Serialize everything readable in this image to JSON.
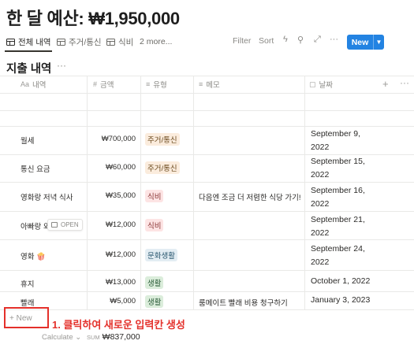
{
  "page": {
    "title": "한 달 예산: ₩1,950,000"
  },
  "views": {
    "tabs": [
      {
        "label": "전체 내역"
      },
      {
        "label": "주거/통신"
      },
      {
        "label": "식비"
      }
    ],
    "more": "2 more..."
  },
  "toolbar": {
    "filter": "Filter",
    "sort": "Sort",
    "new_label": "New",
    "icons": [
      "lightning-icon",
      "search-icon",
      "expand-icon",
      "more-icon"
    ]
  },
  "section": {
    "title": "지출 내역",
    "more": "···"
  },
  "columns": [
    {
      "icon": "Aa",
      "label": "내역"
    },
    {
      "icon": "#",
      "label": "금액"
    },
    {
      "icon": "≡",
      "label": "유형"
    },
    {
      "icon": "≡",
      "label": "메모"
    },
    {
      "icon": "▢",
      "label": "날짜"
    }
  ],
  "rows": [
    {
      "name": "월세",
      "amount": "₩700,000",
      "type": "주거/통신",
      "memo": "",
      "date": [
        "September 9,",
        "2022"
      ]
    },
    {
      "name": "통신 요금",
      "amount": "₩60,000",
      "type": "주거/통신",
      "memo": "",
      "date": [
        "September 15,",
        "2022"
      ]
    },
    {
      "name": "영화랑 저녁 식사",
      "amount": "₩35,000",
      "type": "식비",
      "memo": "다음엔 조금 더 저렴한 식당 가기!",
      "date": [
        "September 16,",
        "2022"
      ]
    },
    {
      "name": "아빠랑 외",
      "amount": "₩12,000",
      "type": "식비",
      "memo": "",
      "date": [
        "September 21,",
        "2022"
      ]
    },
    {
      "name": "영화 🍿",
      "amount": "₩12,000",
      "type": "문화생활",
      "memo": "",
      "date": [
        "September 24,",
        "2022"
      ]
    },
    {
      "name": "휴지",
      "amount": "₩13,000",
      "type": "생활",
      "memo": "",
      "date": [
        "October 1, 2022"
      ]
    },
    {
      "name": "빨래",
      "amount": "₩5,000",
      "type": "생활",
      "memo": "룸메이트 빨래 비용 청구하기",
      "date": [
        "January 3, 2023"
      ]
    }
  ],
  "row_open_label": "OPEN",
  "new_row_label": "New",
  "annotation": "1. 클릭하여 새로운 입력칸 생성",
  "footer": {
    "calculate": "Calculate",
    "sum_prefix": "SUM",
    "sum_value": "₩837,000"
  },
  "colors": {
    "accent": "#2383e2",
    "annotation": "#e4302a",
    "tag_housing": "#fbecdd",
    "tag_food": "#fde4e4",
    "tag_culture": "#e3edf3",
    "tag_living": "#dbeddb"
  }
}
